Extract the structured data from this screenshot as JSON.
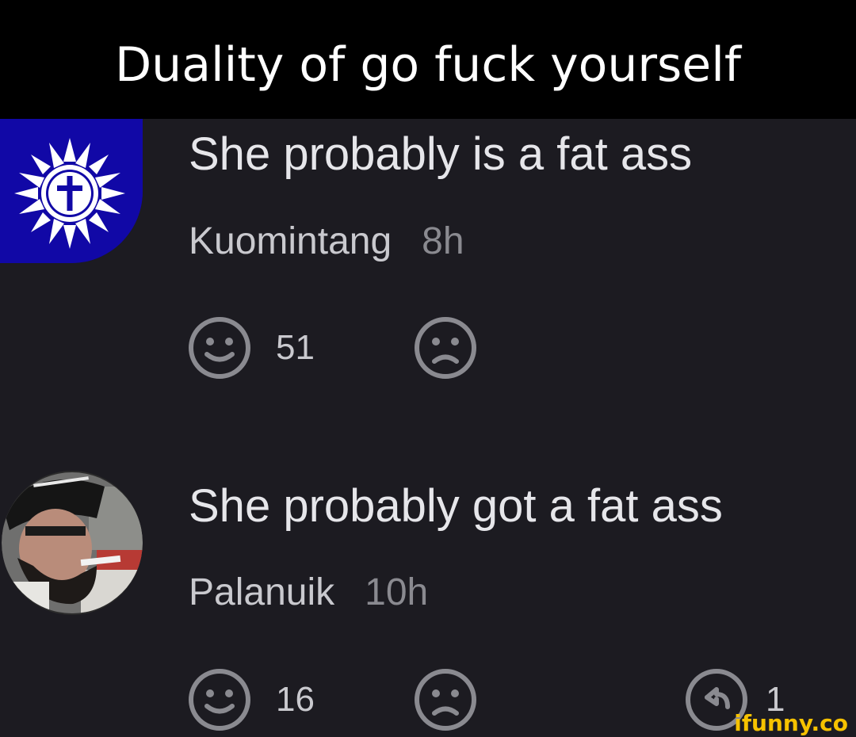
{
  "caption": "Duality of go fuck yourself",
  "comments": [
    {
      "text": "She probably is a fat ass",
      "user": "Kuomintang",
      "time": "8h",
      "likes": "51",
      "avatar_icon": "kuomintang-flag-cross-icon"
    },
    {
      "text": "She probably got a fat ass",
      "user": "Palanuik",
      "time": "10h",
      "likes": "16",
      "replies": "1",
      "avatar_icon": "pirate-man-photo"
    }
  ],
  "watermark": "ifunny.co",
  "colors": {
    "background": "#1c1b21",
    "caption_bar": "#000000",
    "avatar_blue": "#1108a6",
    "icon_gray": "#8a8a90",
    "watermark": "#f6c200"
  }
}
